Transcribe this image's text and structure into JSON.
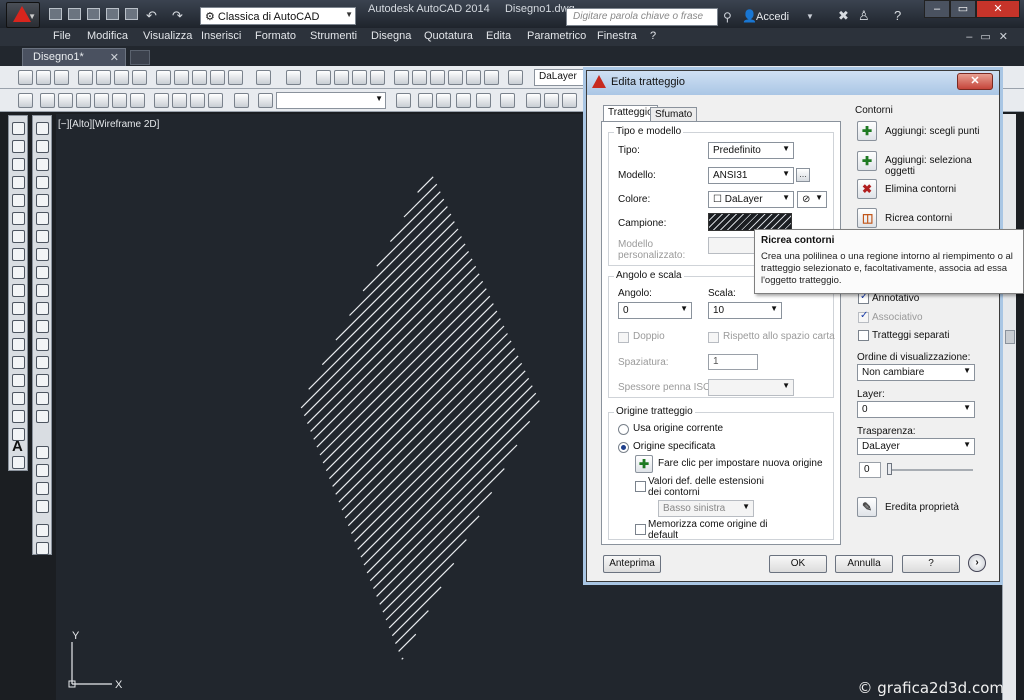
{
  "window": {
    "workspace": "Classica di AutoCAD",
    "app_name": "Autodesk AutoCAD 2014",
    "document_name": "Disegno1.dwg",
    "search_placeholder": "Digitare parola chiave o frase",
    "login": "Accedi"
  },
  "menu": [
    "File",
    "Modifica",
    "Visualizza",
    "Inserisci",
    "Formato",
    "Strumenti",
    "Disegna",
    "Quotatura",
    "Edita",
    "Parametrico",
    "Finestra",
    "?"
  ],
  "doc_tab": "Disegno1*",
  "toolbar": {
    "layer_combo": "DaLayer"
  },
  "viewport_label": "[−][Alto][Wireframe 2D]",
  "ucs": {
    "x_label": "X",
    "y_label": "Y"
  },
  "watermark": "© grafica2d3d.com",
  "dialog": {
    "title": "Edita tratteggio",
    "tabs": [
      "Tratteggio",
      "Sfumato"
    ],
    "type_pattern": {
      "group": "Tipo e modello",
      "type_label": "Tipo:",
      "type_value": "Predefinito",
      "pattern_label": "Modello:",
      "pattern_value": "ANSI31",
      "color_label": "Colore:",
      "color_value": "DaLayer",
      "swatch_label": "Campione:",
      "custom_label": "Modello personalizzato:"
    },
    "angle_scale": {
      "group": "Angolo e scala",
      "angle_label": "Angolo:",
      "angle_value": "0",
      "scale_label": "Scala:",
      "scale_value": "10",
      "double": "Doppio",
      "relative_paper": "Rispetto allo spazio carta",
      "spacing_label": "Spaziatura:",
      "spacing_value": "1",
      "iso_label": "Spessore penna ISO:"
    },
    "origin": {
      "group": "Origine tratteggio",
      "use_current": "Usa origine corrente",
      "specified": "Origine specificata",
      "click_set": "Fare clic per impostare nuova origine",
      "default_extents": "Valori def. delle estensioni dei contorni",
      "extents_value": "Basso sinistra",
      "store_default": "Memorizza come origine di default"
    },
    "boundaries": {
      "group": "Contorni",
      "add_pick": "Aggiungi: scegli punti",
      "add_select_1": "Aggiungi: seleziona",
      "add_select_2": "oggetti",
      "remove": "Elimina contorni",
      "recreate": "Ricrea contorni"
    },
    "options": {
      "annotative": "Annotativo",
      "associative": "Associativo",
      "separate": "Tratteggi separati",
      "draw_order_label": "Ordine di visualizzazione:",
      "draw_order_value": "Non cambiare",
      "layer_label": "Layer:",
      "layer_value": "0",
      "transparency_label": "Trasparenza:",
      "transparency_value": "DaLayer",
      "transparency_amount": "0"
    },
    "inherit": "Eredita proprietà",
    "buttons": {
      "preview": "Anteprima",
      "ok": "OK",
      "cancel": "Annulla",
      "help": "?"
    }
  },
  "tooltip": {
    "title": "Ricrea contorni",
    "text": "Crea una polilinea o una regione intorno al riempimento o al tratteggio selezionato e, facoltativamente, associa ad essa l'oggetto tratteggio."
  }
}
